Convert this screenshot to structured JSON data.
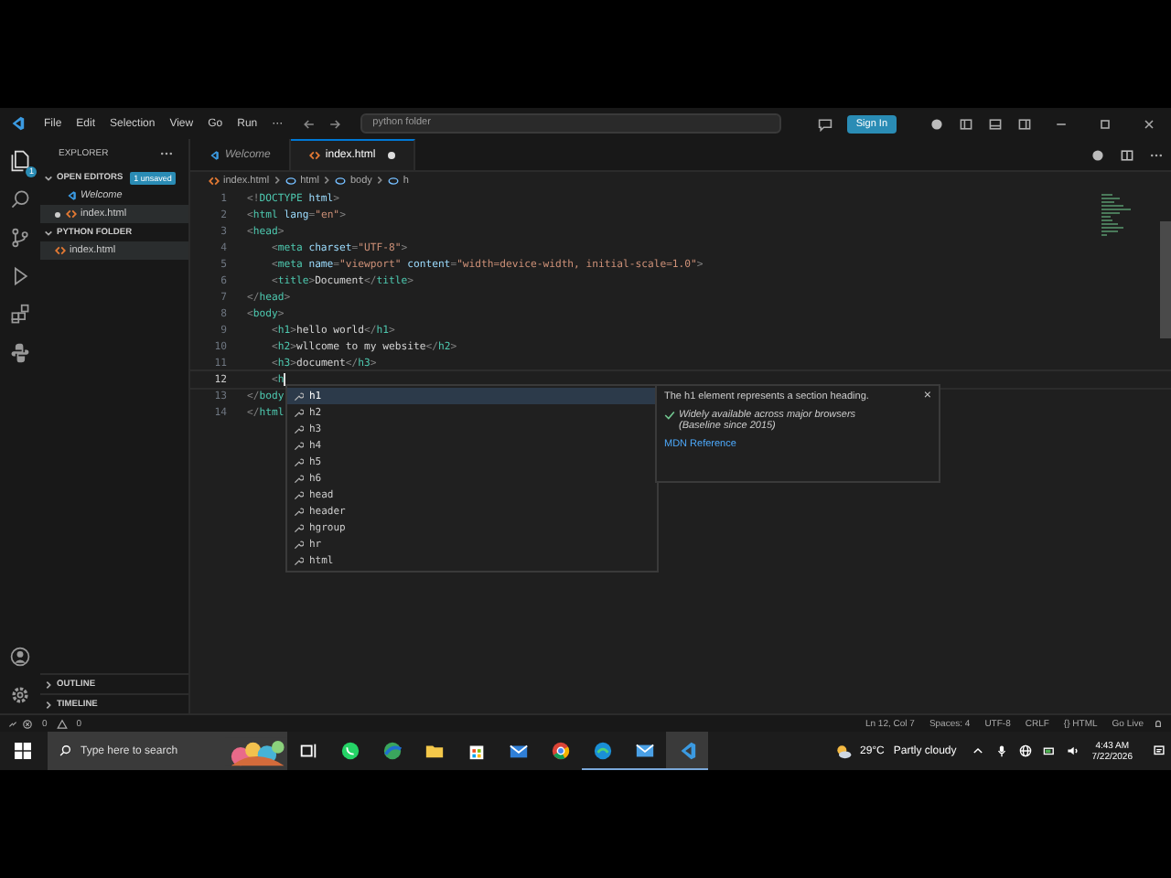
{
  "title_bar": {
    "menu": [
      "File",
      "Edit",
      "Selection",
      "View",
      "Go",
      "Run",
      "···"
    ],
    "search": {
      "value": "python folder"
    },
    "sign_in": "Sign In"
  },
  "activity_bar": {
    "explorer_badge": "1"
  },
  "sidebar": {
    "title": "EXPLORER",
    "sections": [
      {
        "label": "OPEN EDITORS",
        "badge": "1 unsaved",
        "expanded": true,
        "items": [
          {
            "label": "Welcome",
            "kind": "vscode",
            "modified": false,
            "selected": false
          },
          {
            "label": "index.html",
            "kind": "html",
            "modified": true,
            "selected": true
          }
        ]
      },
      {
        "label": "PYTHON FOLDER",
        "expanded": true,
        "items": [
          {
            "label": "index.html",
            "kind": "html",
            "modified": false,
            "selected": true
          }
        ]
      }
    ],
    "bottom_sections": [
      {
        "label": "OUTLINE",
        "expanded": false
      },
      {
        "label": "TIMELINE",
        "expanded": false
      }
    ]
  },
  "tabs": [
    {
      "label": "Welcome",
      "kind": "vscode",
      "selected": false,
      "modified": false
    },
    {
      "label": "index.html",
      "kind": "html",
      "selected": true,
      "modified": true
    }
  ],
  "breadcrumbs": [
    {
      "label": "index.html",
      "kind": "html"
    },
    {
      "label": "html",
      "kind": "element"
    },
    {
      "label": "body",
      "kind": "element"
    },
    {
      "label": "h",
      "kind": "element"
    }
  ],
  "code": [
    {
      "number": "1",
      "current": false,
      "segments": [
        {
          "kind": "punct",
          "text": "<!"
        },
        {
          "kind": "tag",
          "text": "DOCTYPE"
        },
        {
          "kind": "attr",
          "text": " html"
        },
        {
          "kind": "punct",
          "text": ">"
        }
      ]
    },
    {
      "number": "2",
      "current": false,
      "segments": [
        {
          "kind": "punct",
          "text": "<"
        },
        {
          "kind": "tag",
          "text": "html"
        },
        {
          "kind": "attr",
          "text": " lang"
        },
        {
          "kind": "punct",
          "text": "="
        },
        {
          "kind": "str",
          "text": "\"en\""
        },
        {
          "kind": "punct",
          "text": ">"
        }
      ]
    },
    {
      "number": "3",
      "current": false,
      "segments": [
        {
          "kind": "punct",
          "text": "<"
        },
        {
          "kind": "tag",
          "text": "head"
        },
        {
          "kind": "punct",
          "text": ">"
        }
      ]
    },
    {
      "number": "4",
      "current": false,
      "segments": [
        {
          "kind": "punct",
          "text": "    <"
        },
        {
          "kind": "tag",
          "text": "meta"
        },
        {
          "kind": "attr",
          "text": " charset"
        },
        {
          "kind": "punct",
          "text": "="
        },
        {
          "kind": "str",
          "text": "\"UTF-8\""
        },
        {
          "kind": "punct",
          "text": ">"
        }
      ]
    },
    {
      "number": "5",
      "current": false,
      "segments": [
        {
          "kind": "punct",
          "text": "    <"
        },
        {
          "kind": "tag",
          "text": "meta"
        },
        {
          "kind": "attr",
          "text": " name"
        },
        {
          "kind": "punct",
          "text": "="
        },
        {
          "kind": "str",
          "text": "\"viewport\""
        },
        {
          "kind": "attr",
          "text": " content"
        },
        {
          "kind": "punct",
          "text": "="
        },
        {
          "kind": "str",
          "text": "\"width=device-width, initial-scale=1.0\""
        },
        {
          "kind": "punct",
          "text": ">"
        }
      ]
    },
    {
      "number": "6",
      "current": false,
      "segments": [
        {
          "kind": "punct",
          "text": "    <"
        },
        {
          "kind": "tag",
          "text": "title"
        },
        {
          "kind": "punct",
          "text": ">"
        },
        {
          "kind": "text",
          "text": "Document"
        },
        {
          "kind": "punct",
          "text": "</"
        },
        {
          "kind": "tag",
          "text": "title"
        },
        {
          "kind": "punct",
          "text": ">"
        }
      ]
    },
    {
      "number": "7",
      "current": false,
      "segments": [
        {
          "kind": "punct",
          "text": "</"
        },
        {
          "kind": "tag",
          "text": "head"
        },
        {
          "kind": "punct",
          "text": ">"
        }
      ]
    },
    {
      "number": "8",
      "current": false,
      "segments": [
        {
          "kind": "punct",
          "text": "<"
        },
        {
          "kind": "tag",
          "text": "body"
        },
        {
          "kind": "punct",
          "text": ">"
        }
      ]
    },
    {
      "number": "9",
      "current": false,
      "segments": [
        {
          "kind": "punct",
          "text": "    <"
        },
        {
          "kind": "tag",
          "text": "h1"
        },
        {
          "kind": "punct",
          "text": ">"
        },
        {
          "kind": "text",
          "text": "hello world"
        },
        {
          "kind": "punct",
          "text": "</"
        },
        {
          "kind": "tag",
          "text": "h1"
        },
        {
          "kind": "punct",
          "text": ">"
        }
      ]
    },
    {
      "number": "10",
      "current": false,
      "segments": [
        {
          "kind": "punct",
          "text": "    <"
        },
        {
          "kind": "tag",
          "text": "h2"
        },
        {
          "kind": "punct",
          "text": ">"
        },
        {
          "kind": "text",
          "text": "wllcome to my website"
        },
        {
          "kind": "punct",
          "text": "</"
        },
        {
          "kind": "tag",
          "text": "h2"
        },
        {
          "kind": "punct",
          "text": ">"
        }
      ]
    },
    {
      "number": "11",
      "current": false,
      "segments": [
        {
          "kind": "punct",
          "text": "    <"
        },
        {
          "kind": "tag",
          "text": "h3"
        },
        {
          "kind": "punct",
          "text": ">"
        },
        {
          "kind": "text",
          "text": "document"
        },
        {
          "kind": "punct",
          "text": "</"
        },
        {
          "kind": "tag",
          "text": "h3"
        },
        {
          "kind": "punct",
          "text": ">"
        }
      ]
    },
    {
      "number": "12",
      "current": true,
      "segments": [
        {
          "kind": "punct",
          "text": "    <"
        },
        {
          "kind": "tag",
          "text": "h"
        }
      ]
    },
    {
      "number": "13",
      "current": false,
      "segments": [
        {
          "kind": "punct",
          "text": "</"
        },
        {
          "kind": "tag",
          "text": "body"
        }
      ]
    },
    {
      "number": "14",
      "current": false,
      "segments": [
        {
          "kind": "punct",
          "text": "</"
        },
        {
          "kind": "tag",
          "text": "html"
        }
      ]
    }
  ],
  "suggestions": [
    {
      "label": "h1",
      "selected": true
    },
    {
      "label": "h2",
      "selected": false
    },
    {
      "label": "h3",
      "selected": false
    },
    {
      "label": "h4",
      "selected": false
    },
    {
      "label": "h5",
      "selected": false
    },
    {
      "label": "h6",
      "selected": false
    },
    {
      "label": "head",
      "selected": false
    },
    {
      "label": "header",
      "selected": false
    },
    {
      "label": "hgroup",
      "selected": false
    },
    {
      "label": "hr",
      "selected": false
    },
    {
      "label": "html",
      "selected": false
    }
  ],
  "suggestion_details": {
    "description": "The h1 element represents a section heading.",
    "baseline": "Widely available across major browsers (Baseline since 2015)",
    "link": "MDN Reference",
    "close": "×"
  },
  "status_bar": {
    "errors": "0",
    "warnings": "0",
    "items": [
      "Ln 12, Col 7",
      "Spaces: 4",
      "UTF-8",
      "CRLF",
      "{} HTML",
      "Go Live"
    ]
  },
  "taskbar": {
    "search_placeholder": "Type here to search",
    "temperature": "29°C",
    "weather": "Partly cloudy",
    "time": "4:43 AM",
    "date": "7/22/2026"
  }
}
